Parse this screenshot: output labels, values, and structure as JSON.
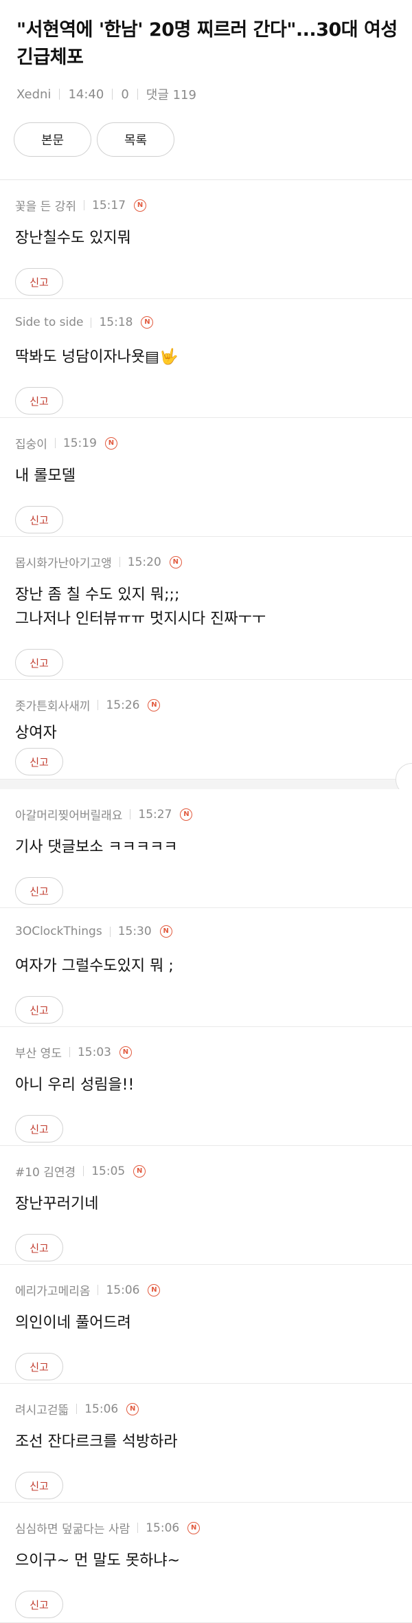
{
  "article": {
    "title": "\"서현역에 '한남' 20명 찌르러 간다\"...30대 여성 긴급체포",
    "author": "Xedni",
    "time": "14:40",
    "views": "0",
    "comments_label": "댓글 119"
  },
  "buttons": {
    "body": "본문",
    "list": "목록"
  },
  "badge_text": "N",
  "report_label": "신고",
  "comments": [
    {
      "nick": "꽃을 든 강쥐",
      "time": "15:17",
      "body": "장난칠수도 있지뭐"
    },
    {
      "nick": "Side to side",
      "time": "15:18",
      "body": "딱봐도 넝담이자나욧▤🤟"
    },
    {
      "nick": "집숭이",
      "time": "15:19",
      "body": "내 롤모델"
    },
    {
      "nick": "몹시화가난아기고앵",
      "time": "15:20",
      "body": "장난 좀 칠 수도 있지 뭐;;;\n그나저나 인터뷰ㅠㅠ 멋지시다 진짜ㅜㅜ"
    },
    {
      "nick": "좃가튼회사새끼",
      "time": "15:26",
      "body": "상여자"
    },
    {
      "nick": "아갈머리찢어버릴래요",
      "time": "15:27",
      "body": "기사 댓글보소 ㅋㅋㅋㅋㅋ"
    },
    {
      "nick": "3OClockThings",
      "time": "15:30",
      "body": "여자가 그럴수도있지 뭐 ;"
    },
    {
      "nick": "부산 영도",
      "time": "15:03",
      "body": "아니 우리 성림을!!"
    },
    {
      "nick": "#10 김연경",
      "time": "15:05",
      "body": "장난꾸러기네"
    },
    {
      "nick": "에리가고메리옴",
      "time": "15:06",
      "body": "의인이네 풀어드려"
    },
    {
      "nick": "려시고걷뜳",
      "time": "15:06",
      "body": "조선 잔다르크를 석방하라"
    },
    {
      "nick": "심심하면 덮굶다는 사람",
      "time": "15:06",
      "body": "으이구~ 먼 말도 못하냐~"
    }
  ]
}
